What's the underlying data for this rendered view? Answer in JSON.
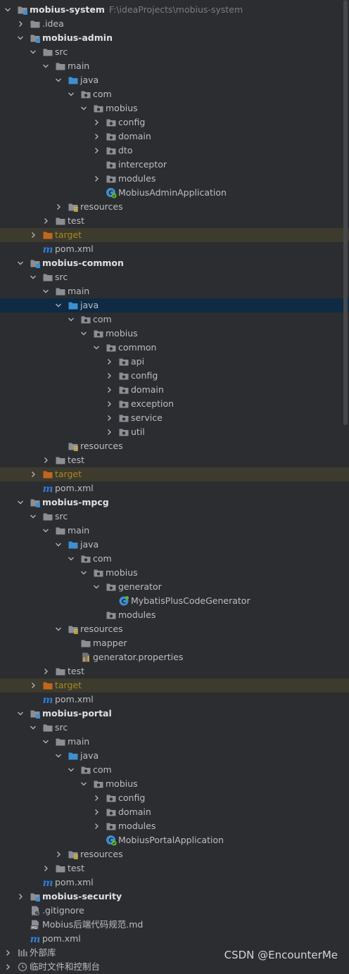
{
  "tree": [
    {
      "label": "mobius-system",
      "path": "F:\\ideaProjects\\mobius-system",
      "indent": 0,
      "arrow": "down",
      "icon": "module-folder-icon",
      "kind": "module"
    },
    {
      "label": ".idea",
      "indent": 1,
      "arrow": "right",
      "icon": "folder-icon"
    },
    {
      "label": "mobius-admin",
      "indent": 1,
      "arrow": "down",
      "icon": "module-folder-icon",
      "kind": "module"
    },
    {
      "label": "src",
      "indent": 2,
      "arrow": "down",
      "icon": "folder-icon"
    },
    {
      "label": "main",
      "indent": 3,
      "arrow": "down",
      "icon": "folder-icon"
    },
    {
      "label": "java",
      "indent": 4,
      "arrow": "down",
      "icon": "source-folder-icon"
    },
    {
      "label": "com",
      "indent": 5,
      "arrow": "down",
      "icon": "package-icon"
    },
    {
      "label": "mobius",
      "indent": 6,
      "arrow": "down",
      "icon": "package-icon"
    },
    {
      "label": "config",
      "indent": 7,
      "arrow": "right",
      "icon": "package-icon"
    },
    {
      "label": "domain",
      "indent": 7,
      "arrow": "right",
      "icon": "package-icon"
    },
    {
      "label": "dto",
      "indent": 7,
      "arrow": "right",
      "icon": "package-icon"
    },
    {
      "label": "interceptor",
      "indent": 7,
      "arrow": "none",
      "icon": "package-icon"
    },
    {
      "label": "modules",
      "indent": 7,
      "arrow": "right",
      "icon": "package-icon"
    },
    {
      "label": "MobiusAdminApplication",
      "indent": 7,
      "arrow": "none",
      "icon": "spring-class-icon"
    },
    {
      "label": "resources",
      "indent": 4,
      "arrow": "right",
      "icon": "resources-folder-icon"
    },
    {
      "label": "test",
      "indent": 3,
      "arrow": "right",
      "icon": "folder-icon"
    },
    {
      "label": "target",
      "indent": 2,
      "arrow": "right",
      "icon": "excluded-folder-icon",
      "kind": "excluded"
    },
    {
      "label": "pom.xml",
      "indent": 2,
      "arrow": "none",
      "icon": "maven-icon"
    },
    {
      "label": "mobius-common",
      "indent": 1,
      "arrow": "down",
      "icon": "module-folder-icon",
      "kind": "module"
    },
    {
      "label": "src",
      "indent": 2,
      "arrow": "down",
      "icon": "folder-icon"
    },
    {
      "label": "main",
      "indent": 3,
      "arrow": "down",
      "icon": "folder-icon"
    },
    {
      "label": "java",
      "indent": 4,
      "arrow": "down",
      "icon": "source-folder-icon",
      "kind": "selected"
    },
    {
      "label": "com",
      "indent": 5,
      "arrow": "down",
      "icon": "package-icon"
    },
    {
      "label": "mobius",
      "indent": 6,
      "arrow": "down",
      "icon": "package-icon"
    },
    {
      "label": "common",
      "indent": 7,
      "arrow": "down",
      "icon": "package-icon"
    },
    {
      "label": "api",
      "indent": 8,
      "arrow": "right",
      "icon": "package-icon"
    },
    {
      "label": "config",
      "indent": 8,
      "arrow": "right",
      "icon": "package-icon"
    },
    {
      "label": "domain",
      "indent": 8,
      "arrow": "right",
      "icon": "package-icon"
    },
    {
      "label": "exception",
      "indent": 8,
      "arrow": "right",
      "icon": "package-icon"
    },
    {
      "label": "service",
      "indent": 8,
      "arrow": "right",
      "icon": "package-icon"
    },
    {
      "label": "util",
      "indent": 8,
      "arrow": "right",
      "icon": "package-icon"
    },
    {
      "label": "resources",
      "indent": 4,
      "arrow": "none",
      "icon": "resources-folder-icon"
    },
    {
      "label": "test",
      "indent": 3,
      "arrow": "right",
      "icon": "folder-icon"
    },
    {
      "label": "target",
      "indent": 2,
      "arrow": "right",
      "icon": "excluded-folder-icon",
      "kind": "excluded"
    },
    {
      "label": "pom.xml",
      "indent": 2,
      "arrow": "none",
      "icon": "maven-icon"
    },
    {
      "label": "mobius-mpcg",
      "indent": 1,
      "arrow": "down",
      "icon": "module-folder-icon",
      "kind": "module"
    },
    {
      "label": "src",
      "indent": 2,
      "arrow": "down",
      "icon": "folder-icon"
    },
    {
      "label": "main",
      "indent": 3,
      "arrow": "down",
      "icon": "folder-icon"
    },
    {
      "label": "java",
      "indent": 4,
      "arrow": "down",
      "icon": "source-folder-icon"
    },
    {
      "label": "com",
      "indent": 5,
      "arrow": "down",
      "icon": "package-icon"
    },
    {
      "label": "mobius",
      "indent": 6,
      "arrow": "down",
      "icon": "package-icon"
    },
    {
      "label": "generator",
      "indent": 7,
      "arrow": "down",
      "icon": "package-icon"
    },
    {
      "label": "MybatisPlusCodeGenerator",
      "indent": 8,
      "arrow": "none",
      "icon": "class-icon"
    },
    {
      "label": "modules",
      "indent": 7,
      "arrow": "none",
      "icon": "package-icon"
    },
    {
      "label": "resources",
      "indent": 4,
      "arrow": "down",
      "icon": "resources-folder-icon"
    },
    {
      "label": "mapper",
      "indent": 5,
      "arrow": "none",
      "icon": "folder-icon"
    },
    {
      "label": "generator.properties",
      "indent": 5,
      "arrow": "none",
      "icon": "properties-file-icon"
    },
    {
      "label": "test",
      "indent": 3,
      "arrow": "right",
      "icon": "folder-icon"
    },
    {
      "label": "target",
      "indent": 2,
      "arrow": "right",
      "icon": "excluded-folder-icon",
      "kind": "excluded"
    },
    {
      "label": "pom.xml",
      "indent": 2,
      "arrow": "none",
      "icon": "maven-icon"
    },
    {
      "label": "mobius-portal",
      "indent": 1,
      "arrow": "down",
      "icon": "module-folder-icon",
      "kind": "module"
    },
    {
      "label": "src",
      "indent": 2,
      "arrow": "down",
      "icon": "folder-icon"
    },
    {
      "label": "main",
      "indent": 3,
      "arrow": "down",
      "icon": "folder-icon"
    },
    {
      "label": "java",
      "indent": 4,
      "arrow": "down",
      "icon": "source-folder-icon"
    },
    {
      "label": "com",
      "indent": 5,
      "arrow": "down",
      "icon": "package-icon"
    },
    {
      "label": "mobius",
      "indent": 6,
      "arrow": "down",
      "icon": "package-icon"
    },
    {
      "label": "config",
      "indent": 7,
      "arrow": "right",
      "icon": "package-icon"
    },
    {
      "label": "domain",
      "indent": 7,
      "arrow": "right",
      "icon": "package-icon"
    },
    {
      "label": "modules",
      "indent": 7,
      "arrow": "right",
      "icon": "package-icon"
    },
    {
      "label": "MobiusPortalApplication",
      "indent": 7,
      "arrow": "none",
      "icon": "spring-class-icon"
    },
    {
      "label": "resources",
      "indent": 4,
      "arrow": "right",
      "icon": "resources-folder-icon"
    },
    {
      "label": "test",
      "indent": 3,
      "arrow": "right",
      "icon": "folder-icon"
    },
    {
      "label": "pom.xml",
      "indent": 2,
      "arrow": "none",
      "icon": "maven-icon"
    },
    {
      "label": "mobius-security",
      "indent": 1,
      "arrow": "right",
      "icon": "module-folder-icon",
      "kind": "module"
    },
    {
      "label": ".gitignore",
      "indent": 1,
      "arrow": "none",
      "icon": "gitignore-file-icon"
    },
    {
      "label": "Mobius后端代码规范.md",
      "indent": 1,
      "arrow": "none",
      "icon": "markdown-file-icon"
    },
    {
      "label": "pom.xml",
      "indent": 1,
      "arrow": "none",
      "icon": "maven-icon"
    },
    {
      "label": "外部库",
      "indent": 0,
      "arrow": "right",
      "icon": "libraries-icon"
    },
    {
      "label": "临时文件和控制台",
      "indent": 0,
      "arrow": "right",
      "icon": "scratches-icon"
    }
  ],
  "colors": {
    "background": "#2b2d30",
    "text": "#bcbec4",
    "selected_row": "#0e2a44",
    "excluded_row": "#3d3a2e",
    "excluded_text": "#a88a1e",
    "folder": "#8b8e95",
    "source_folder": "#3d8fd1",
    "excluded_folder": "#c2661d",
    "spring": "#5fb832",
    "maven": "#2f7dd6"
  },
  "watermark": "CSDN @EncounterMe"
}
